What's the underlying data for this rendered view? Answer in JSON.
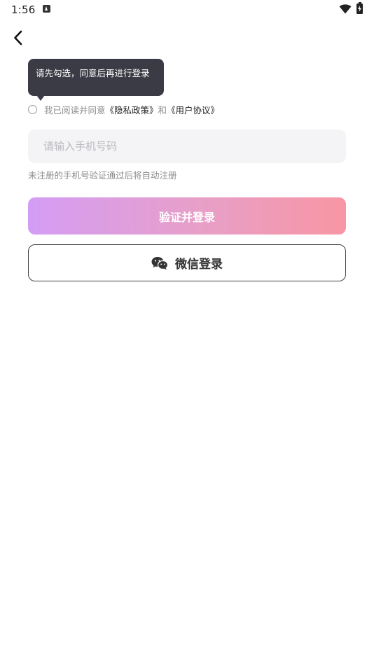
{
  "status_bar": {
    "time": "1:56"
  },
  "icons": {
    "back": "chevron-left-icon",
    "notification": "app-notification-icon",
    "wifi": "wifi-icon",
    "battery": "battery-charging-icon",
    "wechat": "wechat-icon"
  },
  "tooltip": {
    "text": "请先勾选，同意后再进行登录"
  },
  "agreement": {
    "prefix": "我已阅读并同意",
    "privacy_policy": "《隐私政策》",
    "conjunction": "和",
    "user_agreement": "《用户协议》",
    "checked": false
  },
  "phone_input": {
    "value": "",
    "placeholder": "请输入手机号码"
  },
  "hint": "未注册的手机号验证通过后将自动注册",
  "buttons": {
    "verify_login": "验证并登录",
    "wechat_login": "微信登录"
  },
  "colors": {
    "gradient_start": "#d49df5",
    "gradient_end": "#f896a4",
    "tooltip_bg": "#3a3b45",
    "input_bg": "#f4f4f6"
  }
}
